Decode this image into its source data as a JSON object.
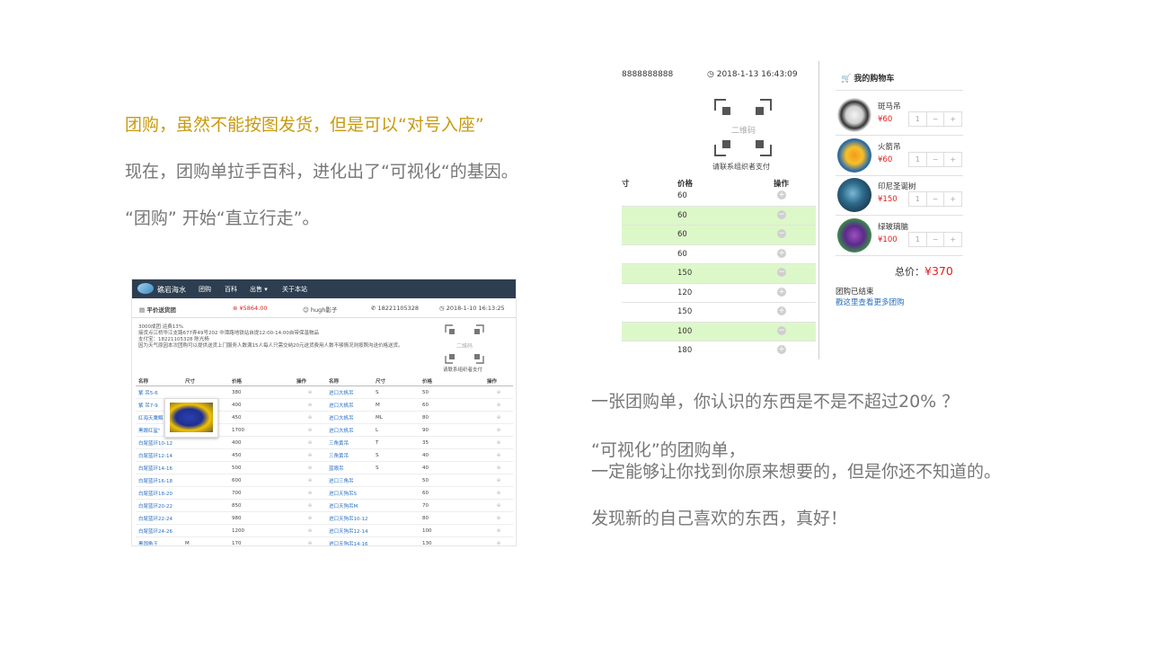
{
  "left_text": {
    "headline": "团购，虽然不能按图发货，但是可以“对号入座”",
    "line2": "现在，团购单拉手百科，进化出了“可视化“的基因。",
    "line3": "“团购” 开始“直立行走”。"
  },
  "right_text": {
    "headline": "一张团购单，你认识的东西是不是不超过20% ？",
    "line2": "“可视化”的团购单，",
    "line3": "一定能够让你找到你原来想要的，但是你还不知道的。",
    "line4": "发现新的自己喜欢的东西，真好！"
  },
  "shot1": {
    "nav": {
      "site_name": "礁岩海水",
      "items": [
        "团购",
        "百科",
        "出售 ▾",
        "关于本站"
      ]
    },
    "info": {
      "title": "平价送货团",
      "amount": "¥5864.00",
      "user": "hugh影子",
      "phone": "18221105328",
      "time": "2018-1-10 16:13:25"
    },
    "paragraph": [
      "3000成团 运费13%",
      "接货点江桥华江支路677弄49号202 中潭路地铁站自提12:00-14:00自带保温物品",
      "支付宝：18221105328 陈光杨",
      "因为天气原因本次团购可以提供送货上门服务人数满15人每人只需交纳20元送货费用人数不够情况则按照沟送价格送货。"
    ],
    "qr_label": "二维码",
    "qr_caption": "请联系组织者支付",
    "headers": [
      "名称",
      "尺寸",
      "价格",
      "操作",
      "名称",
      "尺寸",
      "价格",
      "操作"
    ],
    "rows": [
      [
        "紫 吊5-6",
        "",
        "380",
        "进口大帆吊",
        "S",
        "50"
      ],
      [
        "紫 吊7-9",
        "",
        "400",
        "进口大帆吊",
        "M",
        "60"
      ],
      [
        "红海天鹰鲷",
        "",
        "450",
        "进口大帆吊",
        "ML",
        "80"
      ],
      [
        "黑眼红鲨\"",
        "",
        "1700",
        "进口大帆吊",
        "L",
        "90"
      ],
      [
        "白尾蓝环10-12",
        "",
        "400",
        "三角黄吊",
        "T",
        "35"
      ],
      [
        "白尾蓝环12-14",
        "",
        "450",
        "三角黄吊",
        "S",
        "40"
      ],
      [
        "白尾蓝环14-16",
        "",
        "500",
        "蓝眼吊",
        "S",
        "40"
      ],
      [
        "白尾蓝环16-18",
        "",
        "600",
        "进口三角吊",
        "",
        "50"
      ],
      [
        "白尾蓝环18-20",
        "",
        "700",
        "进口天狗吊S",
        "",
        "60"
      ],
      [
        "白尾蓝环20-22",
        "",
        "850",
        "进口天狗吊M",
        "",
        "70"
      ],
      [
        "白尾蓝环22-24",
        "",
        "980",
        "进口天狗吊10-12",
        "",
        "80"
      ],
      [
        "白尾蓝环24-26",
        "",
        "1200",
        "进口天狗吊12-14",
        "",
        "100"
      ],
      [
        "黑国龟王",
        "M",
        "170",
        "进口天狗吊14-16",
        "",
        "130"
      ]
    ]
  },
  "shot2": {
    "phone": "8888888888",
    "time": "2018-1-13 16:43:09",
    "qr_label": "二维码",
    "qr_caption": "请联系组织者支付",
    "headers": {
      "size_suffix": "寸",
      "price": "价格",
      "op": "操作"
    },
    "rows": [
      {
        "price": "60",
        "op": "+",
        "hl": false
      },
      {
        "price": "60",
        "op": "−",
        "hl": true
      },
      {
        "price": "60",
        "op": "−",
        "hl": true
      },
      {
        "price": "60",
        "op": "+",
        "hl": false
      },
      {
        "price": "150",
        "op": "−",
        "hl": true
      },
      {
        "price": "120",
        "op": "+",
        "hl": false
      },
      {
        "price": "150",
        "op": "+",
        "hl": false
      },
      {
        "price": "100",
        "op": "−",
        "hl": true
      },
      {
        "price": "180",
        "op": "+",
        "hl": false
      }
    ],
    "cart": {
      "title": "我的购物车",
      "items": [
        {
          "name": "斑马吊",
          "price": "¥60",
          "qty": "1"
        },
        {
          "name": "火箭吊",
          "price": "¥60",
          "qty": "1"
        },
        {
          "name": "印尼圣诞树",
          "price": "¥150",
          "qty": "1"
        },
        {
          "name": "绿玻璃脑",
          "price": "¥100",
          "qty": "1"
        }
      ],
      "total_label": "总价：",
      "total_value": "¥370",
      "status": "团购已结束",
      "more_link": "戳这里查看更多团购"
    }
  }
}
